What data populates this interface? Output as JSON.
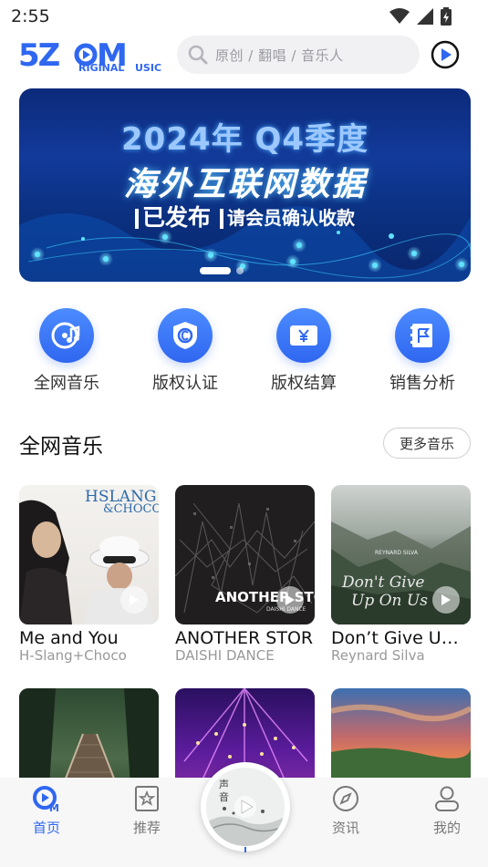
{
  "status": {
    "time": "2:55"
  },
  "header": {
    "logo_text": "5ZOM ORIGINAL MUSIC",
    "search_placeholder": "原创 / 翻唱 / 音乐人"
  },
  "banner": {
    "line1": "2024年 Q4季度",
    "line2": "海外互联网数据",
    "line3a": "已发布",
    "line3b": "请会员确认收款",
    "page_count": 2,
    "active_page": 0
  },
  "entries": [
    {
      "label": "全网音乐",
      "icon": "music-disc-icon"
    },
    {
      "label": "版权认证",
      "icon": "shield-c-icon"
    },
    {
      "label": "版权结算",
      "icon": "yuan-card-icon"
    },
    {
      "label": "销售分析",
      "icon": "flag-book-icon"
    }
  ],
  "section": {
    "title": "全网音乐",
    "more_label": "更多音乐"
  },
  "songs": [
    {
      "title": "Me and You",
      "artist": "H-Slang+Choco",
      "cover_text": "HSLANG & CHOCO"
    },
    {
      "title": "ANOTHER STOR",
      "artist": "DAISHI DANCE",
      "cover_text": "ANOTHER STORY"
    },
    {
      "title": "Don’t Give U…",
      "artist": "Reynard Silva",
      "cover_text": "Don't Give Up On Us"
    }
  ],
  "nav": [
    {
      "label": "首页",
      "icon": "home-music-icon",
      "active": true
    },
    {
      "label": "推荐",
      "icon": "star-box-icon",
      "active": false
    },
    {
      "label": "资讯",
      "icon": "compass-icon",
      "active": false
    },
    {
      "label": "我的",
      "icon": "user-icon",
      "active": false
    }
  ],
  "colors": {
    "accent": "#2f67f0",
    "banner_bg": "#0c2a7a"
  }
}
